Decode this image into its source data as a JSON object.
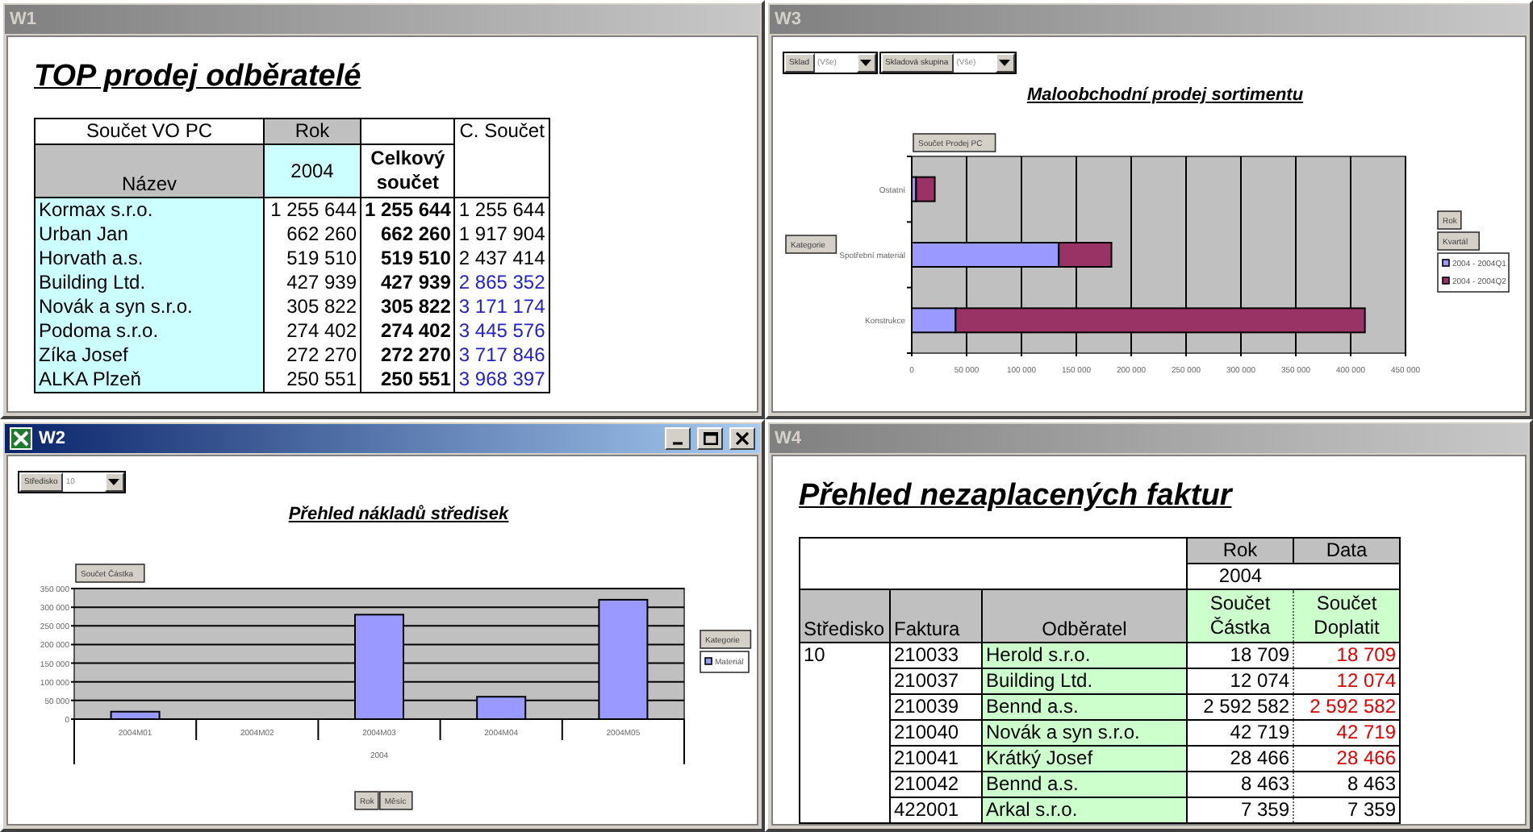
{
  "windows": [
    {
      "title": "W1",
      "active": false,
      "kind": "top_table",
      "heading": "TOP prodej odběratelé",
      "table": {
        "corner": "Součet VO PC",
        "column_field": "Rok",
        "row_field": "Název",
        "column_item": "2004",
        "total_heading": "Celkový součet",
        "extra_heading": "C. Součet",
        "rows": [
          {
            "name": "Kormax s.r.o.",
            "value": "1 255 644",
            "total": "1 255 644",
            "cumulative": "1 255 644",
            "highlighted": false
          },
          {
            "name": "Urban Jan",
            "value": "662 260",
            "total": "662 260",
            "cumulative": "1 917 904",
            "highlighted": false
          },
          {
            "name": "Horvath a.s.",
            "value": "519 510",
            "total": "519 510",
            "cumulative": "2 437 414",
            "highlighted": false
          },
          {
            "name": "Building Ltd.",
            "value": "427 939",
            "total": "427 939",
            "cumulative": "2 865 352",
            "highlighted": true
          },
          {
            "name": "Novák a syn s.r.o.",
            "value": "305 822",
            "total": "305 822",
            "cumulative": "3 171 174",
            "highlighted": true
          },
          {
            "name": "Podoma s.r.o.",
            "value": "274 402",
            "total": "274 402",
            "cumulative": "3 445 576",
            "highlighted": true
          },
          {
            "name": "Zíka Josef",
            "value": "272 270",
            "total": "272 270",
            "cumulative": "3 717 846",
            "highlighted": true
          },
          {
            "name": "ALKA Plzeň",
            "value": "250 551",
            "total": "250 551",
            "cumulative": "3 968 397",
            "highlighted": true
          }
        ]
      }
    },
    {
      "title": "W3",
      "active": false,
      "kind": "pivot_chart",
      "filters": [
        {
          "field": "Sklad",
          "value": "(Vše)"
        },
        {
          "field": "Skladová skupina",
          "value": "(Vše)"
        }
      ],
      "heading": "Maloobchodní prodej sortimentu",
      "field_buttons": [
        {
          "label": "Součet Prodej PC",
          "kind": "data"
        },
        {
          "label": "Kategorie",
          "kind": "category"
        },
        {
          "label": "Rok",
          "kind": "series"
        },
        {
          "label": "Kvartál",
          "kind": "series"
        }
      ],
      "chart_data": {
        "type": "bar",
        "orientation": "horizontal",
        "stacked": true,
        "grid": true,
        "legend": "right",
        "categories": [
          "Ostatní",
          "Spotřební materiál",
          "Konstrukce"
        ],
        "series": [
          {
            "name": "2004 - 2004Q1",
            "color": "#9999ff",
            "values": [
              4000,
              134000,
              40000
            ]
          },
          {
            "name": "2004 - 2004Q2",
            "color": "#993366",
            "values": [
              17000,
              48000,
              373000
            ]
          }
        ],
        "xlim": [
          0,
          450000
        ],
        "xticks": [
          0,
          {
            "value": 50000,
            "label": "50 000"
          },
          {
            "value": 100000,
            "label": "100 000"
          },
          {
            "value": 150000,
            "label": "150 000"
          },
          {
            "value": 200000,
            "label": "200 000"
          },
          {
            "value": 250000,
            "label": "250 000"
          },
          {
            "value": 300000,
            "label": "300 000"
          },
          {
            "value": 350000,
            "label": "350 000"
          },
          {
            "value": 400000,
            "label": "400 000"
          },
          {
            "value": 450000,
            "label": "450 000"
          }
        ]
      }
    },
    {
      "title": "W2",
      "active": true,
      "kind": "pivot_chart",
      "filters": [
        {
          "field": "Středisko",
          "value": "10"
        }
      ],
      "heading": "Přehled nákladů středisek",
      "field_buttons": [
        {
          "label": "Součet Částka",
          "kind": "data"
        },
        {
          "label": "Kategorie",
          "kind": "series"
        },
        {
          "label": "Rok",
          "kind": "category"
        },
        {
          "label": "Měsíc",
          "kind": "category"
        }
      ],
      "chart_data": {
        "type": "bar",
        "orientation": "vertical",
        "grid": true,
        "legend": "right",
        "categories": [
          "2004M01",
          "2004M02",
          "2004M03",
          "2004M04",
          "2004M05"
        ],
        "xlabel": "2004",
        "series": [
          {
            "name": "Materiál",
            "color": "#9999ff",
            "values": [
              20000,
              0,
              280000,
              60000,
              320000
            ]
          }
        ],
        "ylim": [
          0,
          350000
        ],
        "yticks": [
          0,
          {
            "value": 50000,
            "label": "50 000"
          },
          {
            "value": 100000,
            "label": "100 000"
          },
          {
            "value": 150000,
            "label": "150 000"
          },
          {
            "value": 200000,
            "label": "200 000"
          },
          {
            "value": 250000,
            "label": "250 000"
          },
          {
            "value": 300000,
            "label": "300 000"
          },
          {
            "value": 350000,
            "label": "350 000"
          }
        ]
      }
    },
    {
      "title": "W4",
      "active": false,
      "kind": "invoice_table",
      "heading": "Přehled nezaplacených faktur",
      "table": {
        "column_field": "Rok",
        "data_field": "Data",
        "column_item": "2004",
        "row_fields": [
          "Středisko",
          "Faktura",
          "Odběratel"
        ],
        "data_headings": [
          "Součet Částka",
          "Součet Doplatit"
        ],
        "groups": [
          {
            "center": "10",
            "rows": [
              {
                "invoice": "210033",
                "customer": "Herold s.r.o.",
                "amount": "18 709",
                "due": "18 709",
                "overdue": true
              },
              {
                "invoice": "210037",
                "customer": "Building Ltd.",
                "amount": "12 074",
                "due": "12 074",
                "overdue": true
              },
              {
                "invoice": "210039",
                "customer": "Bennd a.s.",
                "amount": "2 592 582",
                "due": "2 592 582",
                "overdue": true
              },
              {
                "invoice": "210040",
                "customer": "Novák a syn s.r.o.",
                "amount": "42 719",
                "due": "42 719",
                "overdue": true
              },
              {
                "invoice": "210041",
                "customer": "Krátký Josef",
                "amount": "28 466",
                "due": "28 466",
                "overdue": true
              },
              {
                "invoice": "210042",
                "customer": "Bennd a.s.",
                "amount": "8 463",
                "due": "8 463",
                "overdue": false
              },
              {
                "invoice": "422001",
                "customer": "Arkal s.r.o.",
                "amount": "7 359",
                "due": "7 359",
                "overdue": false
              }
            ]
          }
        ]
      }
    }
  ]
}
